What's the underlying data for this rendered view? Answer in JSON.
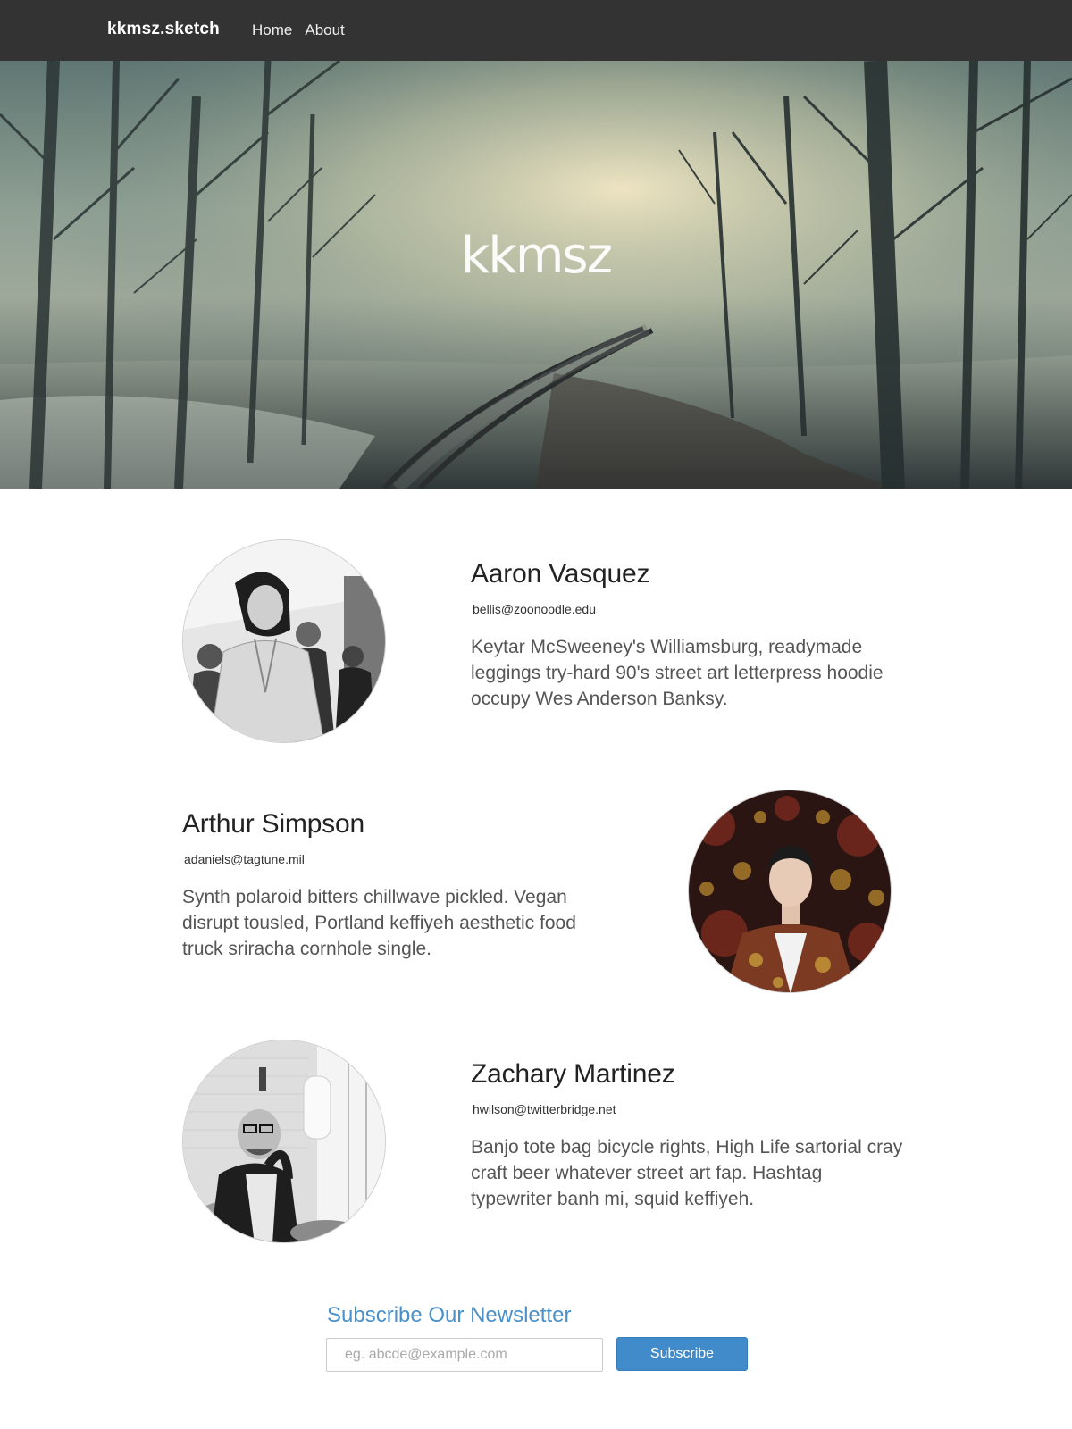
{
  "navbar": {
    "brand": "kkmsz.sketch",
    "links": [
      {
        "label": "Home"
      },
      {
        "label": "About"
      }
    ]
  },
  "hero": {
    "title": "kkmsz"
  },
  "profiles": [
    {
      "name": "Aaron Vasquez",
      "email": "bellis@zoonoodle.edu",
      "bio": "Keytar McSweeney's Williamsburg, readymade leggings try-hard 90's street art letterpress hoodie occupy Wes Anderson Banksy."
    },
    {
      "name": "Arthur Simpson",
      "email": "adaniels@tagtune.mil",
      "bio": "Synth polaroid bitters chillwave pickled. Vegan disrupt tousled, Portland keffiyeh aesthetic food truck sriracha cornhole single."
    },
    {
      "name": "Zachary Martinez",
      "email": "hwilson@twitterbridge.net",
      "bio": "Banjo tote bag bicycle rights, High Life sartorial cray craft beer whatever street art fap. Hashtag typewriter banh mi, squid keffiyeh."
    }
  ],
  "newsletter": {
    "title": "Subscribe Our Newsletter",
    "input_placeholder": "eg. abcde@example.com",
    "button_label": "Subscribe"
  }
}
